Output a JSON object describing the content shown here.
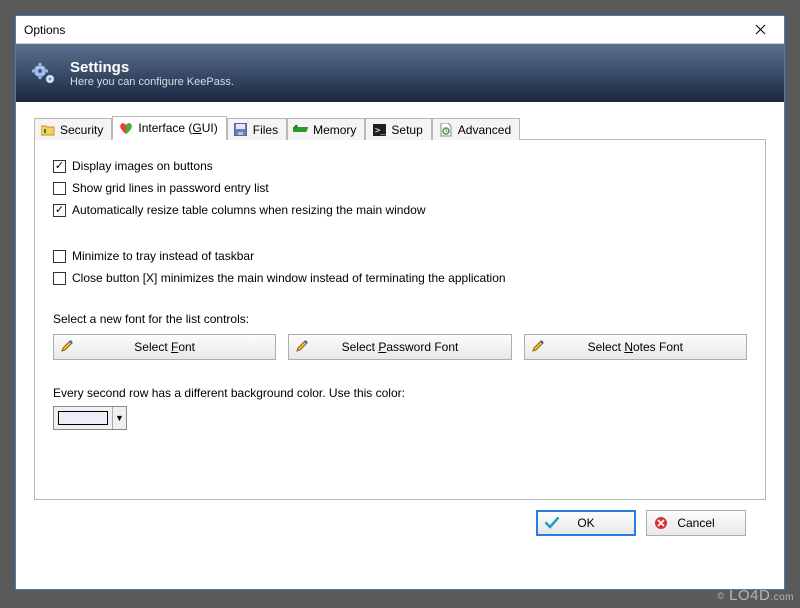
{
  "window": {
    "title": "Options"
  },
  "banner": {
    "title": "Settings",
    "subtitle": "Here you can configure KeePass."
  },
  "tabs": {
    "security": "Security",
    "interface_prefix": "Interface (",
    "interface_accel": "G",
    "interface_suffix": "UI)",
    "files": "Files",
    "memory": "Memory",
    "setup": "Setup",
    "advanced": "Advanced"
  },
  "checks": {
    "c1": "Display images on buttons",
    "c2": "Show grid lines in password entry list",
    "c3": "Automatically resize table columns when resizing the main window",
    "c4": "Minimize to tray instead of taskbar",
    "c5": "Close button [X] minimizes the main window instead of terminating the application"
  },
  "font_section_label": "Select a new font for the list controls:",
  "font_buttons": {
    "b1_pre": "Select ",
    "b1_accel": "F",
    "b1_post": "ont",
    "b2_pre": "Select ",
    "b2_accel": "P",
    "b2_post": "assword Font",
    "b3_pre": "Select ",
    "b3_accel": "N",
    "b3_post": "otes Font"
  },
  "color_label": "Every second row has a different background color. Use this color:",
  "row_color": "#eeeef8",
  "buttons": {
    "ok": "OK",
    "cancel": "Cancel"
  },
  "watermark": {
    "site": "LO4D",
    "tld": ".com"
  }
}
